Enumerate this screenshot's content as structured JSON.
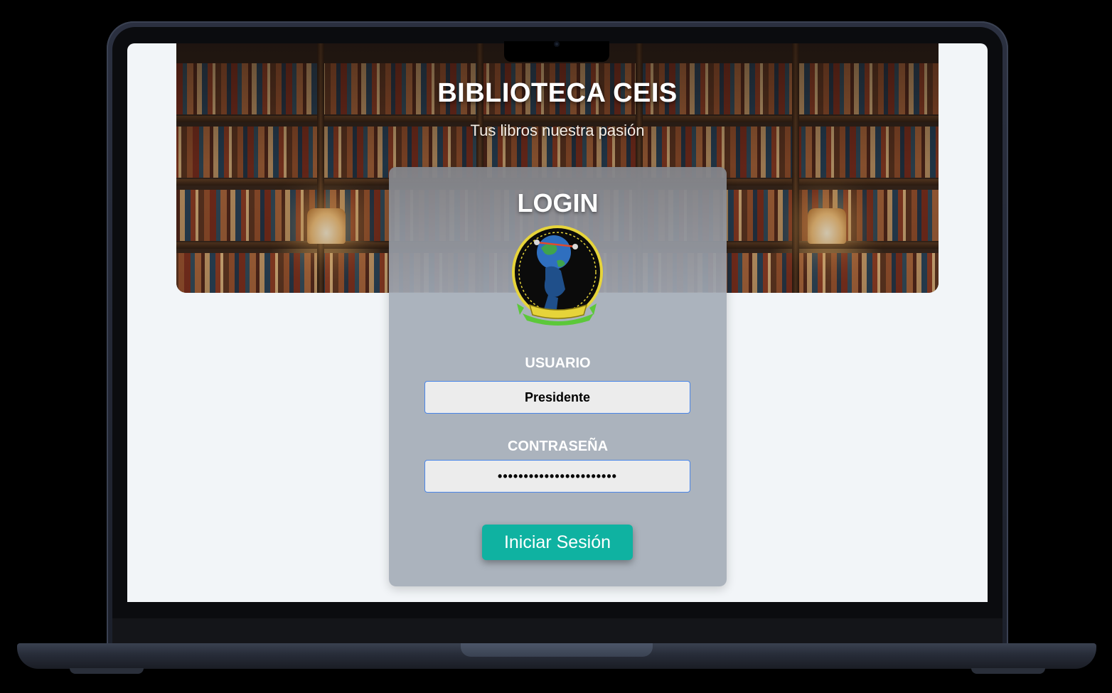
{
  "header": {
    "title": "BIBLIOTECA CEIS",
    "subtitle": "Tus libros nuestra pasión"
  },
  "login": {
    "title": "LOGIN",
    "username_label": "USUARIO",
    "username_value": "Presidente",
    "password_label": "CONTRASEÑA",
    "password_value": "•••••••••••••••••••••••",
    "submit_label": "Iniciar Sesión"
  },
  "colors": {
    "button": "#0fb2a1",
    "card": "#a6adb8",
    "input_border": "#4a86e8",
    "page_background": "#f2f5f8"
  },
  "icons": {
    "logo": "atlas-globe-emblem-icon"
  }
}
